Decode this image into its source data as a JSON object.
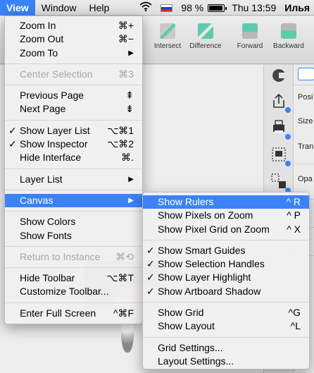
{
  "menubar": {
    "items": [
      "View",
      "Window",
      "Help"
    ],
    "battery": "98 %",
    "clock": "Thu 13:59",
    "user": "Илья"
  },
  "toolbar": {
    "buttons": [
      "Intersect",
      "Difference",
      "Forward",
      "Backward"
    ]
  },
  "inspector": {
    "labels": [
      "Posi",
      "Size",
      "Tran",
      "Opa"
    ]
  },
  "view_menu": {
    "items": [
      {
        "label": "Zoom In",
        "shortcut": "⌘+"
      },
      {
        "label": "Zoom Out",
        "shortcut": "⌘−"
      },
      {
        "label": "Zoom To",
        "arrow": "▶"
      },
      {
        "label": "Center Selection",
        "shortcut": "⌘3"
      },
      {
        "label": "Previous Page",
        "shortcut": "⇞"
      },
      {
        "label": "Next Page",
        "shortcut": "⇟"
      },
      {
        "label": "Show Layer List",
        "shortcut": "⌥⌘1",
        "check": "✓"
      },
      {
        "label": "Show Inspector",
        "shortcut": "⌥⌘2",
        "check": "✓"
      },
      {
        "label": "Hide Interface",
        "shortcut": "⌘."
      },
      {
        "label": "Layer List",
        "arrow": "▶"
      },
      {
        "label": "Canvas",
        "arrow": "▶"
      },
      {
        "label": "Show Colors"
      },
      {
        "label": "Show Fonts"
      },
      {
        "label": "Return to Instance",
        "shortcut": "⌘⟲"
      },
      {
        "label": "Hide Toolbar",
        "shortcut": "⌥⌘T"
      },
      {
        "label": "Customize Toolbar..."
      },
      {
        "label": "Enter Full Screen",
        "shortcut": "^⌘F"
      }
    ]
  },
  "canvas_menu": {
    "items": [
      {
        "label": "Show Rulers",
        "shortcut": "^ R"
      },
      {
        "label": "Show Pixels on Zoom",
        "shortcut": "^ P"
      },
      {
        "label": "Show Pixel Grid on Zoom",
        "shortcut": "^ X"
      },
      {
        "label": "Show Smart Guides",
        "check": "✓"
      },
      {
        "label": "Show Selection Handles",
        "check": "✓"
      },
      {
        "label": "Show Layer Highlight",
        "check": "✓"
      },
      {
        "label": "Show Artboard Shadow",
        "check": "✓"
      },
      {
        "label": "Show Grid",
        "shortcut": "^G"
      },
      {
        "label": "Show Layout",
        "shortcut": "^L"
      },
      {
        "label": "Grid Settings..."
      },
      {
        "label": "Layout Settings..."
      }
    ]
  },
  "colors": {
    "highlight": "#3b82f6",
    "disabled_text": "#a6a6a6"
  }
}
